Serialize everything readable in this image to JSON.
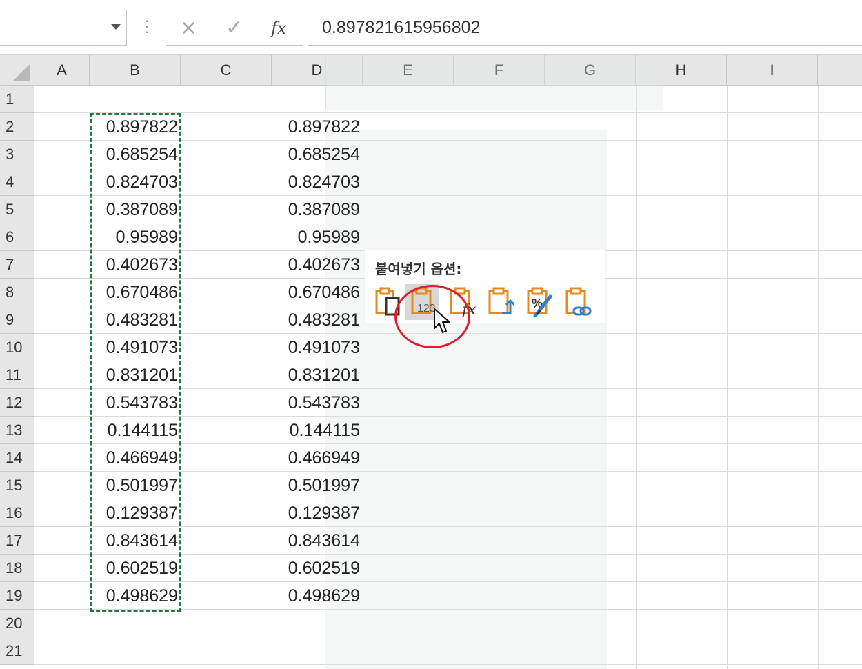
{
  "formula_bar": {
    "name_box": "",
    "cancel_icon": "×",
    "enter_icon": "✓",
    "fx_icon": "fx",
    "formula_value": "0.897821615956802"
  },
  "columns": [
    "A",
    "B",
    "C",
    "D",
    "E",
    "F",
    "G",
    "H",
    "I"
  ],
  "rows": [
    "1",
    "2",
    "3",
    "4",
    "5",
    "6",
    "7",
    "8",
    "9",
    "10",
    "11",
    "12",
    "13",
    "14",
    "15",
    "16",
    "17",
    "18",
    "19",
    "20",
    "21"
  ],
  "column_b_values": [
    "0.897822",
    "0.685254",
    "0.824703",
    "0.387089",
    "0.95989",
    "0.402673",
    "0.670486",
    "0.483281",
    "0.491073",
    "0.831201",
    "0.543783",
    "0.144115",
    "0.466949",
    "0.501997",
    "0.129387",
    "0.843614",
    "0.602519",
    "0.498629"
  ],
  "column_d_values": [
    "0.897822",
    "0.685254",
    "0.824703",
    "0.387089",
    "0.95989",
    "0.402673",
    "0.670486",
    "0.483281",
    "0.491073",
    "0.831201",
    "0.543783",
    "0.144115",
    "0.466949",
    "0.501997",
    "0.129387",
    "0.843614",
    "0.602519",
    "0.498629"
  ],
  "paste_options": {
    "title": "붙여넣기 옵션:",
    "items": [
      "paste-icon",
      "paste-values-icon",
      "paste-formulas-icon",
      "paste-transpose-icon",
      "paste-formatting-icon",
      "paste-link-icon"
    ],
    "values_badge": "123",
    "formatting_badge": "%",
    "formulas_badge": "fx",
    "highlighted": "paste-values-icon"
  },
  "colors": {
    "copy_border": "#1f7a42",
    "clipboard_orange": "#e58a1f",
    "accent_blue": "#2f7fd1",
    "highlight_circle": "#e01d2b"
  }
}
